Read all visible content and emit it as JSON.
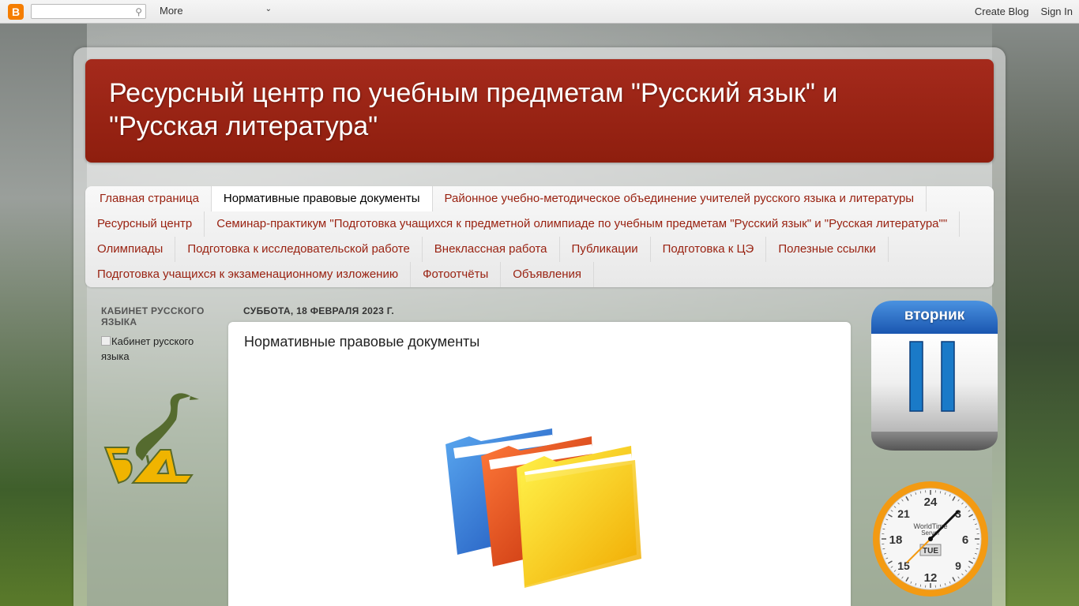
{
  "navbar": {
    "logo_letter": "B",
    "more_label": "More",
    "create_blog": "Create Blog",
    "sign_in": "Sign In"
  },
  "header": {
    "title": "Ресурсный центр по учебным предметам \"Русский язык\" и \"Русская литература\""
  },
  "tabs": {
    "rows": [
      [
        "Главная страница",
        "Нормативные правовые документы",
        "Районное учебно-методическое объединение учителей русского языка и литературы"
      ],
      [
        "Ресурсный центр",
        "Семинар-практикум \"Подготовка учащихся к предметной олимпиаде по учебным предметам \"Русский язык\" и \"Русская литература\"\""
      ],
      [
        "Олимпиады",
        "Подготовка к исследовательской работе",
        "Внеклассная работа",
        "Публикации",
        "Подготовка к ЦЭ",
        "Полезные ссылки"
      ],
      [
        "Подготовка учащихся к экзаменационному изложению",
        "Фотоотчёты",
        "Объявления"
      ]
    ],
    "selected": "Нормативные правовые документы"
  },
  "sidebar": {
    "title": "КАБИНЕТ РУССКОГО ЯЗЫКА",
    "image_alt": "Кабинет русского языка",
    "logo_letters": "БД"
  },
  "post": {
    "date": "СУББОТА, 18 ФЕВРАЛЯ 2023 Г.",
    "title": "Нормативные правовые документы"
  },
  "calendar": {
    "weekday": "вторник",
    "day": "11"
  },
  "clock": {
    "numbers": [
      "24",
      "3",
      "6",
      "9",
      "12",
      "15",
      "18",
      "21"
    ],
    "brand": "WorldTime",
    "brand2": "Server",
    "day_label": "TUE"
  },
  "colors": {
    "header_bg": "#9a2414",
    "tab_text": "#992211",
    "clock_rim": "#f39a12",
    "calendar_top": "#2a6cc4",
    "calendar_digit": "#1a7ac8"
  }
}
